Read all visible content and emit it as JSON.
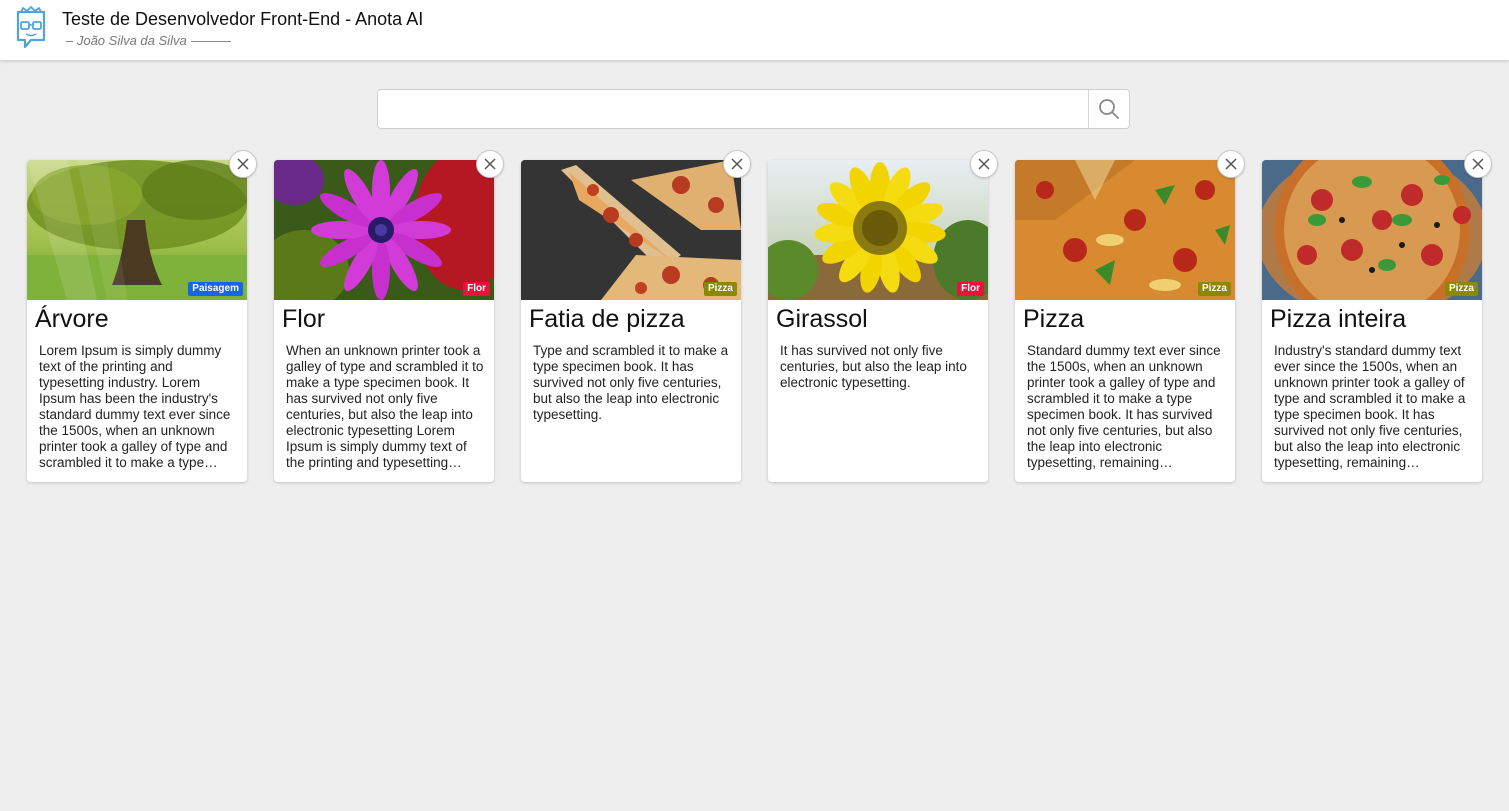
{
  "header": {
    "title": "Teste de Desenvolvedor Front-End - Anota AI",
    "subtitle": "– João Silva da Silva"
  },
  "search": {
    "value": "",
    "placeholder": ""
  },
  "colors": {
    "paisagem": "#1565e8",
    "flor": "#e8123c",
    "pizza": "#8a8a00"
  },
  "cards": [
    {
      "title": "Árvore",
      "badge": "Paisagem",
      "description": "Lorem Ipsum is simply dummy text of the printing and typesetting industry. Lorem Ipsum has been the industry's standard dummy text ever since the 1500s, when an unknown printer took a galley of type and scrambled it to make a type specimen book."
    },
    {
      "title": "Flor",
      "badge": "Flor",
      "description": "When an unknown printer took a galley of type and scrambled it to make a type specimen book. It has survived not only five centuries, but also the leap into electronic typesetting Lorem Ipsum is simply dummy text of the printing and typesetting industry."
    },
    {
      "title": "Fatia de pizza",
      "badge": "Pizza",
      "description": "Type and scrambled it to make a type specimen book. It has survived not only five centuries, but also the leap into electronic typesetting."
    },
    {
      "title": "Girassol",
      "badge": "Flor",
      "description": "It has survived not only five centuries, but also the leap into electronic typesetting."
    },
    {
      "title": "Pizza",
      "badge": "Pizza",
      "description": "Standard dummy text ever since the 1500s, when an unknown printer took a galley of type and scrambled it to make a type specimen book. It has survived not only five centuries, but also the leap into electronic typesetting, remaining essentially unchanged."
    },
    {
      "title": "Pizza inteira",
      "badge": "Pizza",
      "description": "Industry's standard dummy text ever since the 1500s, when an unknown printer took a galley of type and scrambled it to make a type specimen book. It has survived not only five centuries, but also the leap into electronic typesetting, remaining essentially unchanged."
    }
  ]
}
